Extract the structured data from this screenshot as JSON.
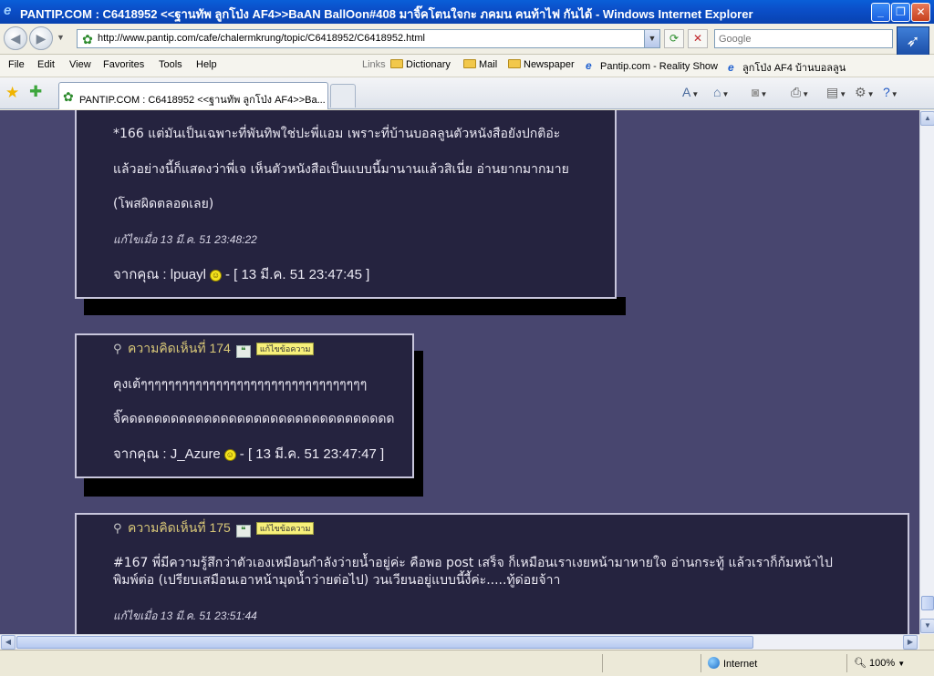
{
  "window": {
    "title": "PANTIP.COM : C6418952 <<ฐานทัพ ลูกโป่ง AF4>>BaAN BallOon#408 มาจิ๊คโตนใจกะ ภคมน คนท้าไฟ กันได้ - Windows Internet Explorer",
    "minimize": "_",
    "maximize": "❐",
    "close": "✕"
  },
  "address": {
    "url": "http://www.pantip.com/cafe/chalermkrung/topic/C6418952/C6418952.html",
    "search_placeholder": "Google"
  },
  "menu": [
    "File",
    "Edit",
    "View",
    "Favorites",
    "Tools",
    "Help"
  ],
  "links": {
    "label": "Links",
    "items": [
      "Dictionary",
      "Mail",
      "Newspaper",
      "Pantip.com - Reality Show",
      "ลูกโป่ง AF4 บ้านบอลลูน"
    ]
  },
  "tab": {
    "label": "PANTIP.COM : C6418952 <<ฐานทัพ ลูกโป่ง AF4>>Ba..."
  },
  "posts": [
    {
      "lines": [
        "*166   แต่มันเป็นเฉพาะที่พันทิพใช่ปะพี่แอม  เพราะที่บ้านบอลลูนตัวหนังสือยังปกติอ่ะ",
        "แล้วอย่างนี้ก็แสดงว่าพี่เจ  เห็นตัวหนังสือเป็นแบบนี้มานานแล้วสิเนี่ย  อ่านยากมากมาย",
        "(โพสผิดตลอดเลย)"
      ],
      "edited": "แก้ไขเมื่อ 13 มี.ค. 51 23:48:22",
      "author_prefix": "จากคุณ : ",
      "author": "lpuayl",
      "time": "- [ 13 มี.ค. 51 23:47:45 ]"
    },
    {
      "title": "ความคิดเห็นที่ 174",
      "quote_label": "แก้ไขข้อความ",
      "lines": [
        "คุงเต้ๆๆๆๆๆๆๆๆๆๆๆๆๆๆๆๆๆๆๆๆๆๆๆๆๆๆๆๆๆๆๆๆๆ",
        "จิ๊คดดดดดดดดดดดดดดดดดดดดดดดดดดดดดดดด"
      ],
      "author_prefix": "จากคุณ : ",
      "author": "J_Azure",
      "time": "- [ 13 มี.ค. 51 23:47:47 ]"
    },
    {
      "title": "ความคิดเห็นที่ 175",
      "quote_label": "แก้ไขข้อความ",
      "lines": [
        "#167 พี่มีความรู้สึกว่าตัวเองเหมือนกำลังว่ายน้ำอยู่ค่ะ  คือพอ post เสร็จ ก็เหมือนเราเงยหน้ามาหายใจ อ่านกระทู้  แล้วเราก็ก้มหน้าไป",
        "พิมพ์ต่อ (เปรียบเสมือนเอาหน้ามุดน้ำว่ายต่อไป)  วนเวียนอยู่แบบนี้งี้ค่ะ.....ทู้ด่อยจ้าา"
      ],
      "edited": "แก้ไขเมื่อ 13 มี.ค. 51 23:51:44"
    }
  ],
  "status": {
    "zone": "Internet",
    "zoom": "100%"
  },
  "icons": {
    "back": "back-arrow-icon",
    "forward": "forward-arrow-icon",
    "refresh": "refresh-icon",
    "stop": "stop-icon",
    "favorites": "star-icon",
    "add_favorites": "add-favorites-icon",
    "home": "home-icon",
    "feeds": "rss-feed-icon",
    "print": "printer-icon",
    "page": "page-icon",
    "tools": "gear-icon",
    "help": "help-icon"
  },
  "colors": {
    "page_bg": "#48466f",
    "card_bg": "#25233f",
    "comment_title": "#d9c878",
    "title_bar": "#0b4fc9"
  }
}
